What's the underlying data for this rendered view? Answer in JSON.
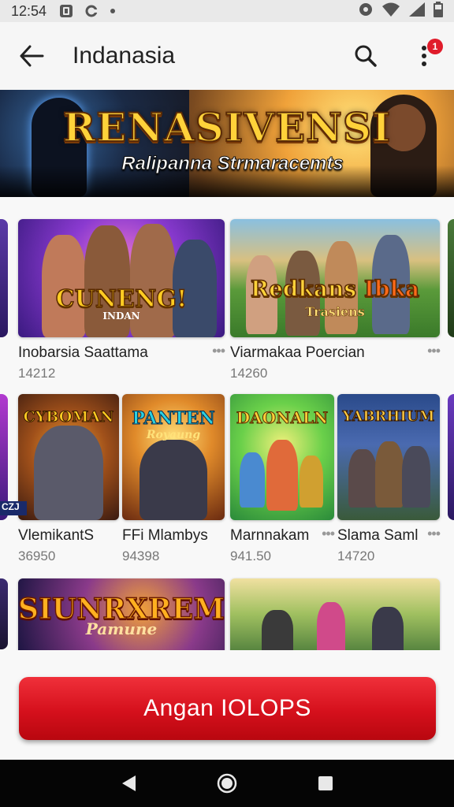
{
  "status_bar": {
    "time": "12:54",
    "left_icons": [
      "app-notification-icon",
      "link-icon",
      "dot-icon"
    ],
    "right_icons": [
      "data-saver-icon",
      "wifi-icon",
      "cellular-icon",
      "battery-icon"
    ]
  },
  "app_bar": {
    "title": "Indanasia",
    "notification_badge": "1"
  },
  "banner": {
    "title": "RENASIVENSI",
    "subtitle": "Ralipanna Strmaracemts"
  },
  "games": [
    {
      "art_title": "CUNENG!",
      "art_sub": "INDAN",
      "name": "Inobarsia Saattama",
      "count": "14212"
    },
    {
      "art_title": "Redkans",
      "art_title2": "Ibka",
      "art_sub": "Trasiens",
      "name": "Viarmakaa Poercian",
      "count": "14260"
    },
    {
      "art_title": "CYBOMAN",
      "art_sub": "",
      "name": "VlemikantS",
      "count": "36950"
    },
    {
      "art_title": "PANTEN",
      "art_sub": "Royaung",
      "name": "FFi Mlambys",
      "count": "94398"
    },
    {
      "art_title": "DAONALN",
      "art_sub": "",
      "name": "Marnnakam",
      "count": "941.50"
    },
    {
      "art_title": "YABRHIUM",
      "art_sub": "",
      "name": "Slama Saml",
      "count": "14720"
    },
    {
      "art_title": "SIUNRXREM",
      "art_sub": "Pamune",
      "name": "",
      "count": ""
    },
    {
      "art_title": "",
      "art_sub": "",
      "name": "",
      "count": ""
    }
  ],
  "peek_labels": {
    "left_card_badge": "CZJ"
  },
  "cta": {
    "label": "Angan IOLOPS"
  },
  "colors": {
    "accent": "#d5101c",
    "badge": "#e01c2b",
    "nav_bg": "#050505"
  }
}
